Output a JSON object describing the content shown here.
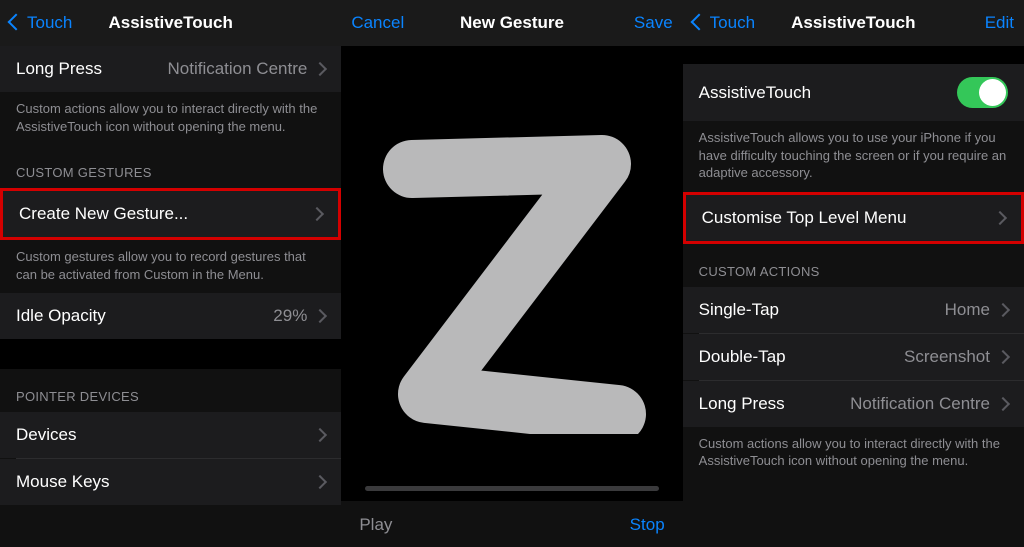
{
  "pane1": {
    "nav": {
      "back": "Touch",
      "title": "AssistiveTouch"
    },
    "row_longpress_label": "Long Press",
    "row_longpress_value": "Notification Centre",
    "footer_actions": "Custom actions allow you to interact directly with the AssistiveTouch icon without opening the menu.",
    "header_custom_gestures": "CUSTOM GESTURES",
    "row_create_gesture": "Create New Gesture...",
    "footer_gestures": "Custom gestures allow you to record gestures that can be activated from Custom in the Menu.",
    "row_idle_opacity_label": "Idle Opacity",
    "row_idle_opacity_value": "29%",
    "header_pointer": "POINTER DEVICES",
    "row_devices": "Devices",
    "row_mouse_keys": "Mouse Keys"
  },
  "pane2": {
    "nav": {
      "cancel": "Cancel",
      "title": "New Gesture",
      "save": "Save"
    },
    "play": "Play",
    "stop": "Stop"
  },
  "pane3": {
    "nav": {
      "back": "Touch",
      "title": "AssistiveTouch",
      "edit": "Edit"
    },
    "row_assistivetouch": "AssistiveTouch",
    "footer_assistivetouch": "AssistiveTouch allows you to use your iPhone if you have difficulty touching the screen or if you require an adaptive accessory.",
    "row_customise_menu": "Customise Top Level Menu",
    "header_custom_actions": "CUSTOM ACTIONS",
    "row_singletap_label": "Single-Tap",
    "row_singletap_value": "Home",
    "row_doubletap_label": "Double-Tap",
    "row_doubletap_value": "Screenshot",
    "row_longpress_label": "Long Press",
    "row_longpress_value": "Notification Centre",
    "footer_actions": "Custom actions allow you to interact directly with the AssistiveTouch icon without opening the menu."
  }
}
